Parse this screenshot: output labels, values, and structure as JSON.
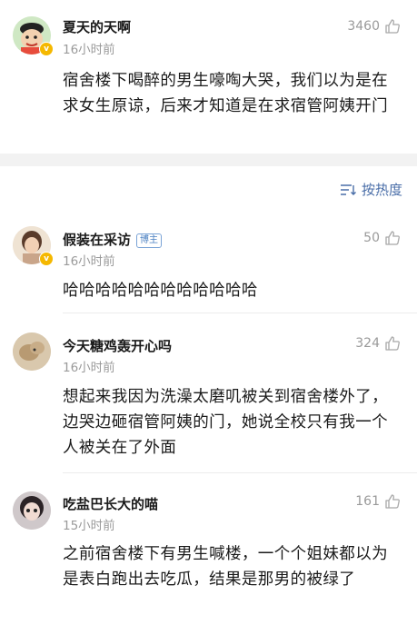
{
  "top_comment": {
    "user": "夏天的天啊",
    "time": "16小时前",
    "likes": "3460",
    "text": "宿舍楼下喝醉的男生嚎啕大哭，我们以为是在求女生原谅，后来才知道是在求宿管阿姨开门"
  },
  "sort_label": "按热度",
  "comments": [
    {
      "user": "假装在采访",
      "tag": "博主",
      "time": "16小时前",
      "likes": "50",
      "text": "哈哈哈哈哈哈哈哈哈哈哈哈"
    },
    {
      "user": "今天糖鸡轰开心吗",
      "time": "16小时前",
      "likes": "324",
      "text": "想起来我因为洗澡太磨叽被关到宿舍楼外了，边哭边砸宿管阿姨的门，她说全校只有我一个人被关在了外面"
    },
    {
      "user": "吃盐巴长大的喵",
      "time": "15小时前",
      "likes": "161",
      "text": "之前宿舍楼下有男生喊楼，一个个姐妹都以为是表白跑出去吃瓜，结果是那男的被绿了"
    }
  ],
  "colors": {
    "accent": "#4a6ea8",
    "muted": "#9a9a9a",
    "verified": "#f5b800",
    "separator": "#f2f2f2"
  },
  "icons": [
    "thumbs-up-icon",
    "sort-icon",
    "verified-badge-icon"
  ]
}
